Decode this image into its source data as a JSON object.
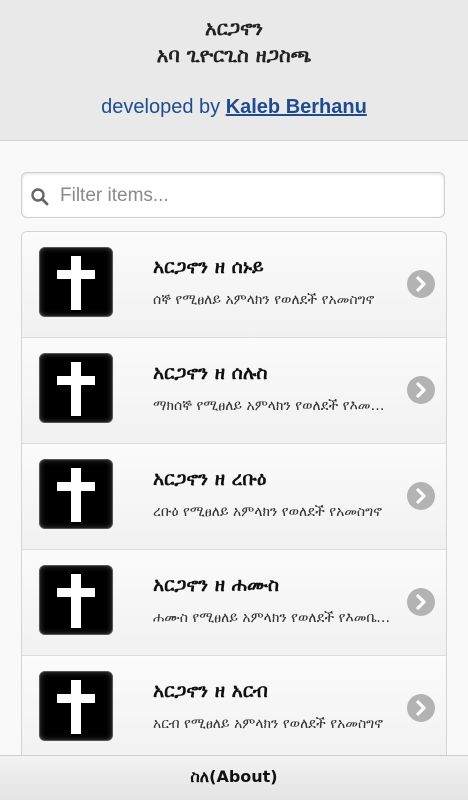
{
  "header": {
    "title_line1": "አርጋኖን",
    "title_line2": "አባ ጊዮርጊስ ዘጋስጫ",
    "developed_by": "developed by ",
    "developer_name": "Kaleb Berhanu"
  },
  "search": {
    "placeholder": "Filter items..."
  },
  "items": [
    {
      "title": "አርጋኖን ዘ ሰኑይ",
      "desc": "ሰኞ የሚፀለይ አምላክን የወለደች የአመስግኖ"
    },
    {
      "title": "አርጋኖን ዘ ሰሉስ",
      "desc": "ማክሰኞ የሚፀለይ አምላክን የወለደች የእመቤታችን"
    },
    {
      "title": "አርጋኖን ዘ ረቡዕ",
      "desc": "ረቡዕ የሚፀለይ አምላክን የወለደች የአመስግኖ"
    },
    {
      "title": "አርጋኖን ዘ ሐሙስ",
      "desc": "ሐሙስ የሚፀለይ አምላክን የወለደች የእመቤታችን"
    },
    {
      "title": "አርጋኖን ዘ አርብ",
      "desc": "አርብ የሚፀለይ አምላክን የወለደች የአመስግኖ"
    }
  ],
  "footer": {
    "about_label": "ስለ(About)"
  }
}
